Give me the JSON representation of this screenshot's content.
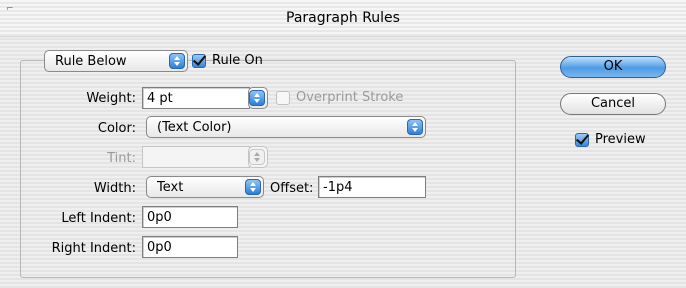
{
  "window": {
    "title": "Paragraph Rules"
  },
  "rule_type": {
    "selected": "Rule Below"
  },
  "rule_on": {
    "label": "Rule On",
    "checked": true
  },
  "weight": {
    "label": "Weight:",
    "value": "4 pt"
  },
  "overprint": {
    "label": "Overprint Stroke",
    "checked": false,
    "enabled": false
  },
  "color": {
    "label": "Color:",
    "value": "(Text Color)"
  },
  "tint": {
    "label": "Tint:",
    "value": ""
  },
  "width": {
    "label": "Width:",
    "value": "Text"
  },
  "offset": {
    "label": "Offset:",
    "value": "-1p4"
  },
  "left_indent": {
    "label": "Left Indent:",
    "value": "0p0"
  },
  "right_indent": {
    "label": "Right Indent:",
    "value": "0p0"
  },
  "buttons": {
    "ok": "OK",
    "cancel": "Cancel"
  },
  "preview": {
    "label": "Preview",
    "checked": true
  }
}
